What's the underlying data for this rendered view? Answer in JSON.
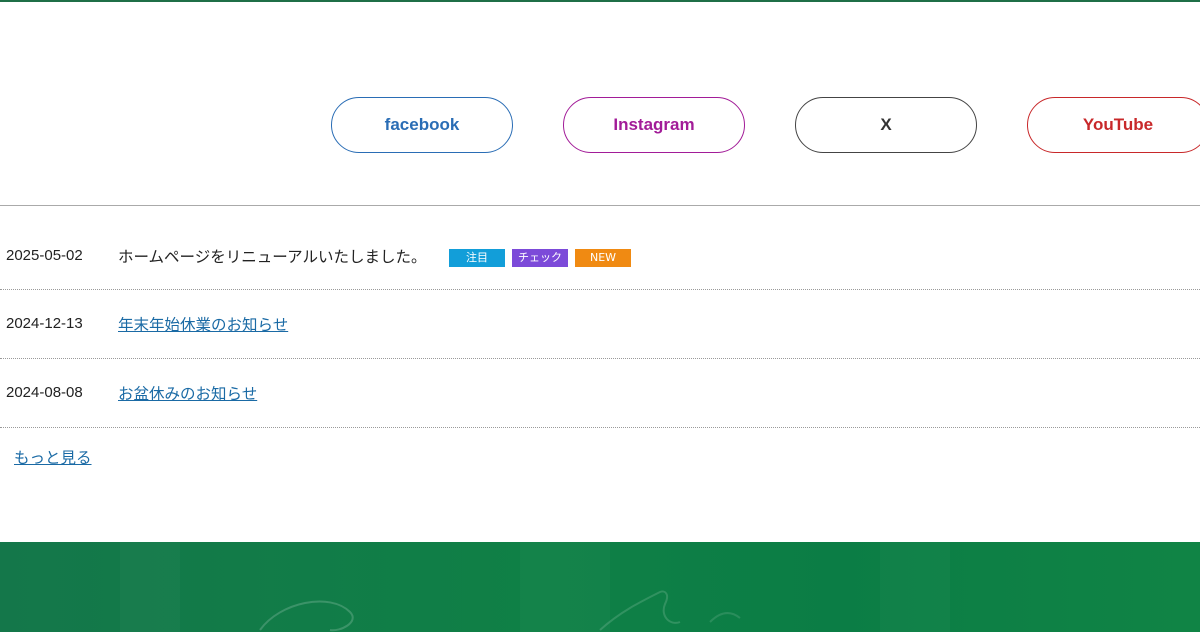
{
  "social": {
    "facebook": {
      "label": "facebook",
      "color": "#2a6db5"
    },
    "instagram": {
      "label": "Instagram",
      "color": "#a21c98"
    },
    "x": {
      "label": "X",
      "color": "#333333"
    },
    "youtube": {
      "label": "YouTube",
      "color": "#c8282a"
    }
  },
  "news": {
    "items": [
      {
        "date": "2025-05-02",
        "title": "ホームページをリニューアルいたしました。",
        "tags": [
          {
            "label": "注目",
            "color": "#129ed9"
          },
          {
            "label": "チェック",
            "color": "#7c4ad9"
          },
          {
            "label": "NEW",
            "color": "#f08a12"
          }
        ]
      },
      {
        "date": "2024-12-13",
        "title": "年末年始休業のお知らせ"
      },
      {
        "date": "2024-08-08",
        "title": "お盆休みのお知らせ"
      }
    ],
    "more_label": "もっと見る"
  },
  "colors": {
    "top_rule": "#1f6f47",
    "footer_band": "#0f8046",
    "link": "#1a6aa5"
  }
}
